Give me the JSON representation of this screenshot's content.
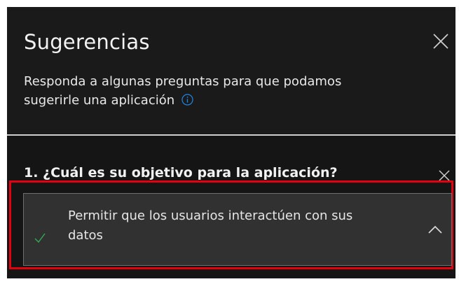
{
  "panel": {
    "title": "Sugerencias",
    "description": "Responda a algunas preguntas para que podamos sugerirle una aplicación",
    "close_icon": "close-icon",
    "info_icon": "info-icon"
  },
  "question": {
    "label": "1. ¿Cuál es su objetivo para la aplicación?",
    "close_icon": "close-icon",
    "selected_option": {
      "label": "Permitir que los usuarios interactúen con sus datos",
      "check_icon": "check-icon",
      "expand_icon": "chevron-up-icon"
    }
  },
  "colors": {
    "background": "#151515",
    "text": "#f2f2f2",
    "info_accent": "#1e88e5",
    "check_accent": "#35a853",
    "highlight": "#e3000f"
  }
}
